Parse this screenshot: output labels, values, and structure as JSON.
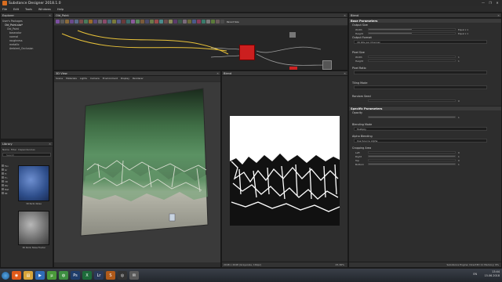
{
  "app": {
    "title": "Substance Designer 2018.1.0",
    "window_buttons": [
      "—",
      "❐",
      "✕"
    ]
  },
  "menu": [
    "File",
    "Edit",
    "Tools",
    "Windows",
    "Help"
  ],
  "explorer": {
    "title": "Explorer",
    "items": [
      "User's Packages",
      "Old_Paint.sbs*",
      "Old_Paint",
      "basecolor",
      "normal",
      "roughness",
      "metallic",
      "Ambient_Occlusion"
    ]
  },
  "graph": {
    "title": "Old_Paint",
    "toolbar_label": "Parent Size",
    "node_label": "Blend"
  },
  "library": {
    "title": "Library",
    "tabs": [
      "Name",
      "Filter",
      "Dependencies"
    ],
    "search_placeholder": "Search",
    "categories": [
      "Fav",
      "Gr",
      "Fl",
      "Fn",
      "3D",
      "Pbr",
      "Mat",
      "Mt"
    ],
    "thumbs": [
      {
        "label": "3D Perlin Noise",
        "color": "#2f4f8c"
      },
      {
        "label": "3D Perlin Noise Fractal",
        "color": "#6a6a6a"
      }
    ]
  },
  "view3d": {
    "title": "3D View",
    "menu": [
      "Scene",
      "Materials",
      "Lights",
      "Camera",
      "Environment",
      "Display",
      "Renderer"
    ]
  },
  "view2d": {
    "title": "Blend",
    "status": "2048 x 2048 (Grayscale, 16bpc)",
    "zoom": "25.36%"
  },
  "params": {
    "title": "Blend",
    "base_header": "Base Parameters",
    "output_size": {
      "label": "Output Size",
      "width_key": "Width",
      "height_key": "Height",
      "width": "Equal x 1",
      "height": "Equal x 1"
    },
    "output_format": {
      "label": "Output Format",
      "value": "16 bits per Channel"
    },
    "pixel_size": {
      "label": "Pixel Size",
      "width_key": "Width",
      "height_key": "Height",
      "width": "1",
      "height": "1"
    },
    "pixel_ratio": {
      "label": "Pixel Ratio"
    },
    "tiling_mode": {
      "label": "Tiling Mode"
    },
    "random_seed": {
      "label": "Random Seed",
      "value": "0"
    },
    "specific_header": "Specific Parameters",
    "opacity": {
      "label": "Opacity",
      "value": "1",
      "level": 1.0
    },
    "blending_mode": {
      "label": "Blending Mode",
      "value": "Multiply"
    },
    "alpha_blending": {
      "label": "Alpha Blending",
      "value": "Use Source Alpha"
    },
    "cropping_area": {
      "label": "Cropping Area",
      "left_key": "Left",
      "right_key": "Right",
      "top_key": "Top",
      "bottom_key": "Bottom",
      "left": "0",
      "right": "1",
      "top": "0",
      "bottom": "1"
    }
  },
  "status_bar": {
    "engine": "Substance Engine: Direct3D 11  Memory: 9%"
  },
  "taskbar": {
    "time": "13:44",
    "date": "15.06.2018",
    "lang": "EN",
    "apps": [
      {
        "name": "firefox",
        "color": "#e05a1a",
        "glyph": "◉"
      },
      {
        "name": "explorer",
        "color": "#d8a53a",
        "glyph": "▤"
      },
      {
        "name": "media",
        "color": "#2f6cb8",
        "glyph": "▶"
      },
      {
        "name": "utorrent",
        "color": "#4a9a3a",
        "glyph": "µ"
      },
      {
        "name": "chrome",
        "color": "#3e8e41",
        "glyph": "◍"
      },
      {
        "name": "photoshop",
        "color": "#1e3d6a",
        "glyph": "Ps"
      },
      {
        "name": "excel",
        "color": "#1d6b3a",
        "glyph": "X"
      },
      {
        "name": "lightroom",
        "color": "#2a3a5a",
        "glyph": "Lr"
      },
      {
        "name": "substance",
        "color": "#b05a1a",
        "glyph": "S"
      },
      {
        "name": "obs",
        "color": "#333333",
        "glyph": "◎"
      },
      {
        "name": "chat",
        "color": "#5a5a5a",
        "glyph": "✉"
      }
    ]
  },
  "colors": {
    "accent": "#d96d1f",
    "node_red": "#cc1f1f",
    "panel": "#2d2d2d"
  }
}
